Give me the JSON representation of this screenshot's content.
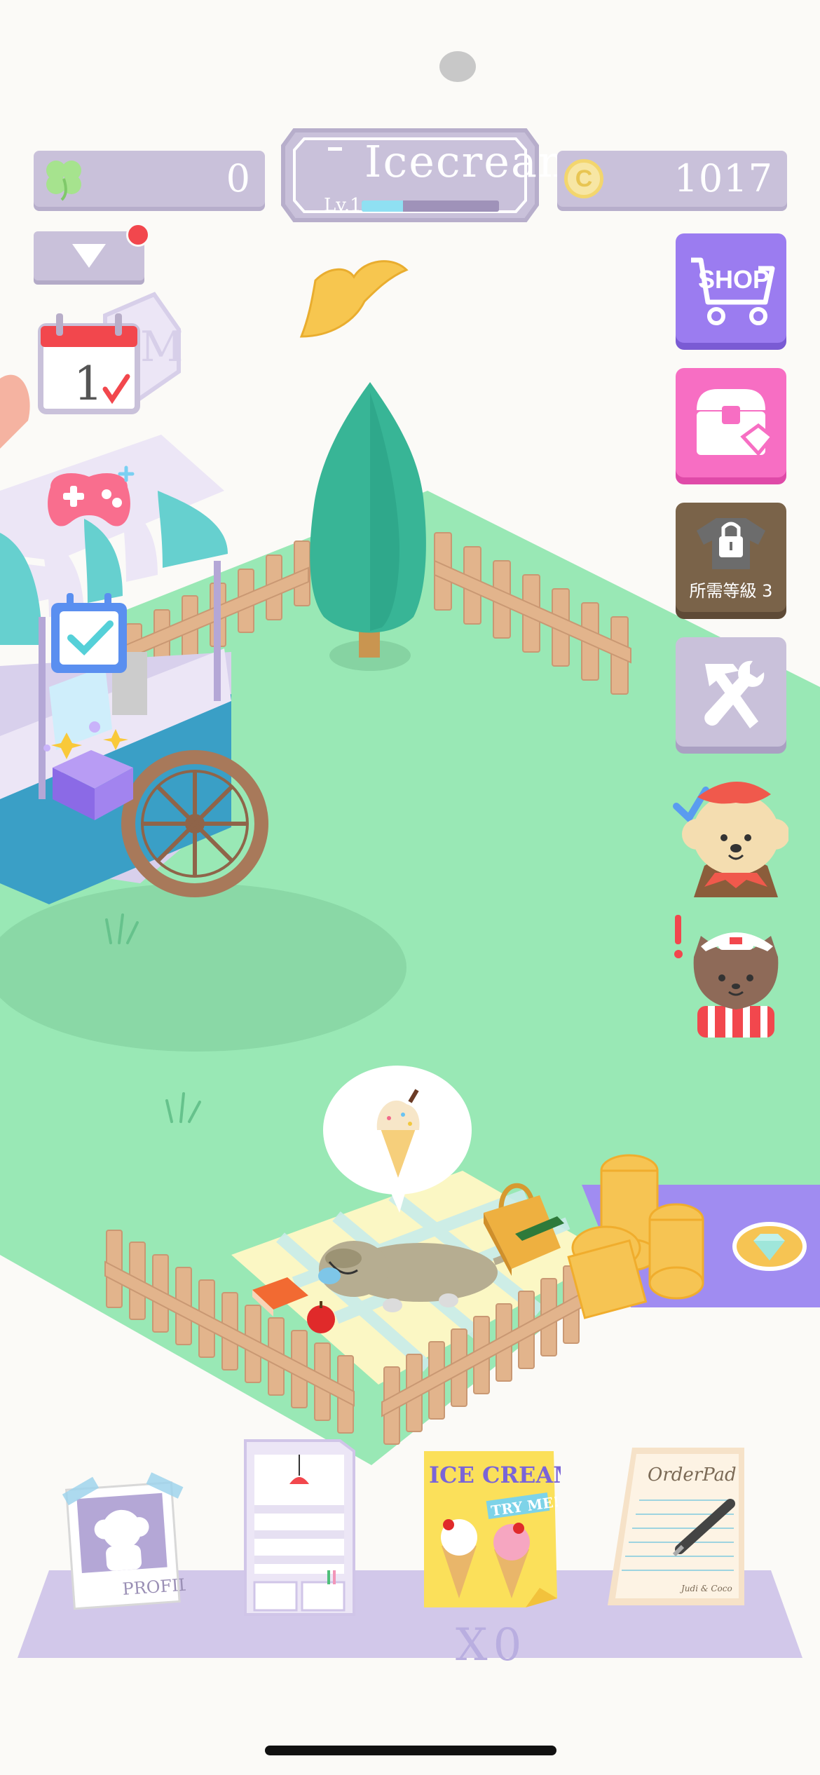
{
  "hud": {
    "clover_count": "0",
    "coin_count": "1017",
    "coin_symbol": "C",
    "shop_name": "Icecream",
    "level_label": "Lv.1",
    "xp_progress": 0.3
  },
  "left_menu": {
    "calendar_day": "1",
    "has_notification": true
  },
  "right_menu": {
    "shop_label": "SHOP",
    "locked_label": "所需等級 3"
  },
  "scene": {
    "speech_bubble_item": "ice-cream-cone",
    "sign_letter": "M"
  },
  "bottom_tray": {
    "profile_label": "PROFILE",
    "poster_title": "ICE CREAM",
    "poster_tag": "TRY ME!",
    "orderpad_label": "OrderPad",
    "orderpad_footer": "Judi & Coco",
    "count": "X0"
  },
  "colors": {
    "grass": "#99e8b5",
    "lavender": "#c9c1da",
    "shop_button": "#9b7cf0",
    "chest_button": "#f76ec3",
    "locked_button": "#7a6349",
    "fence": "#e2b48c"
  }
}
